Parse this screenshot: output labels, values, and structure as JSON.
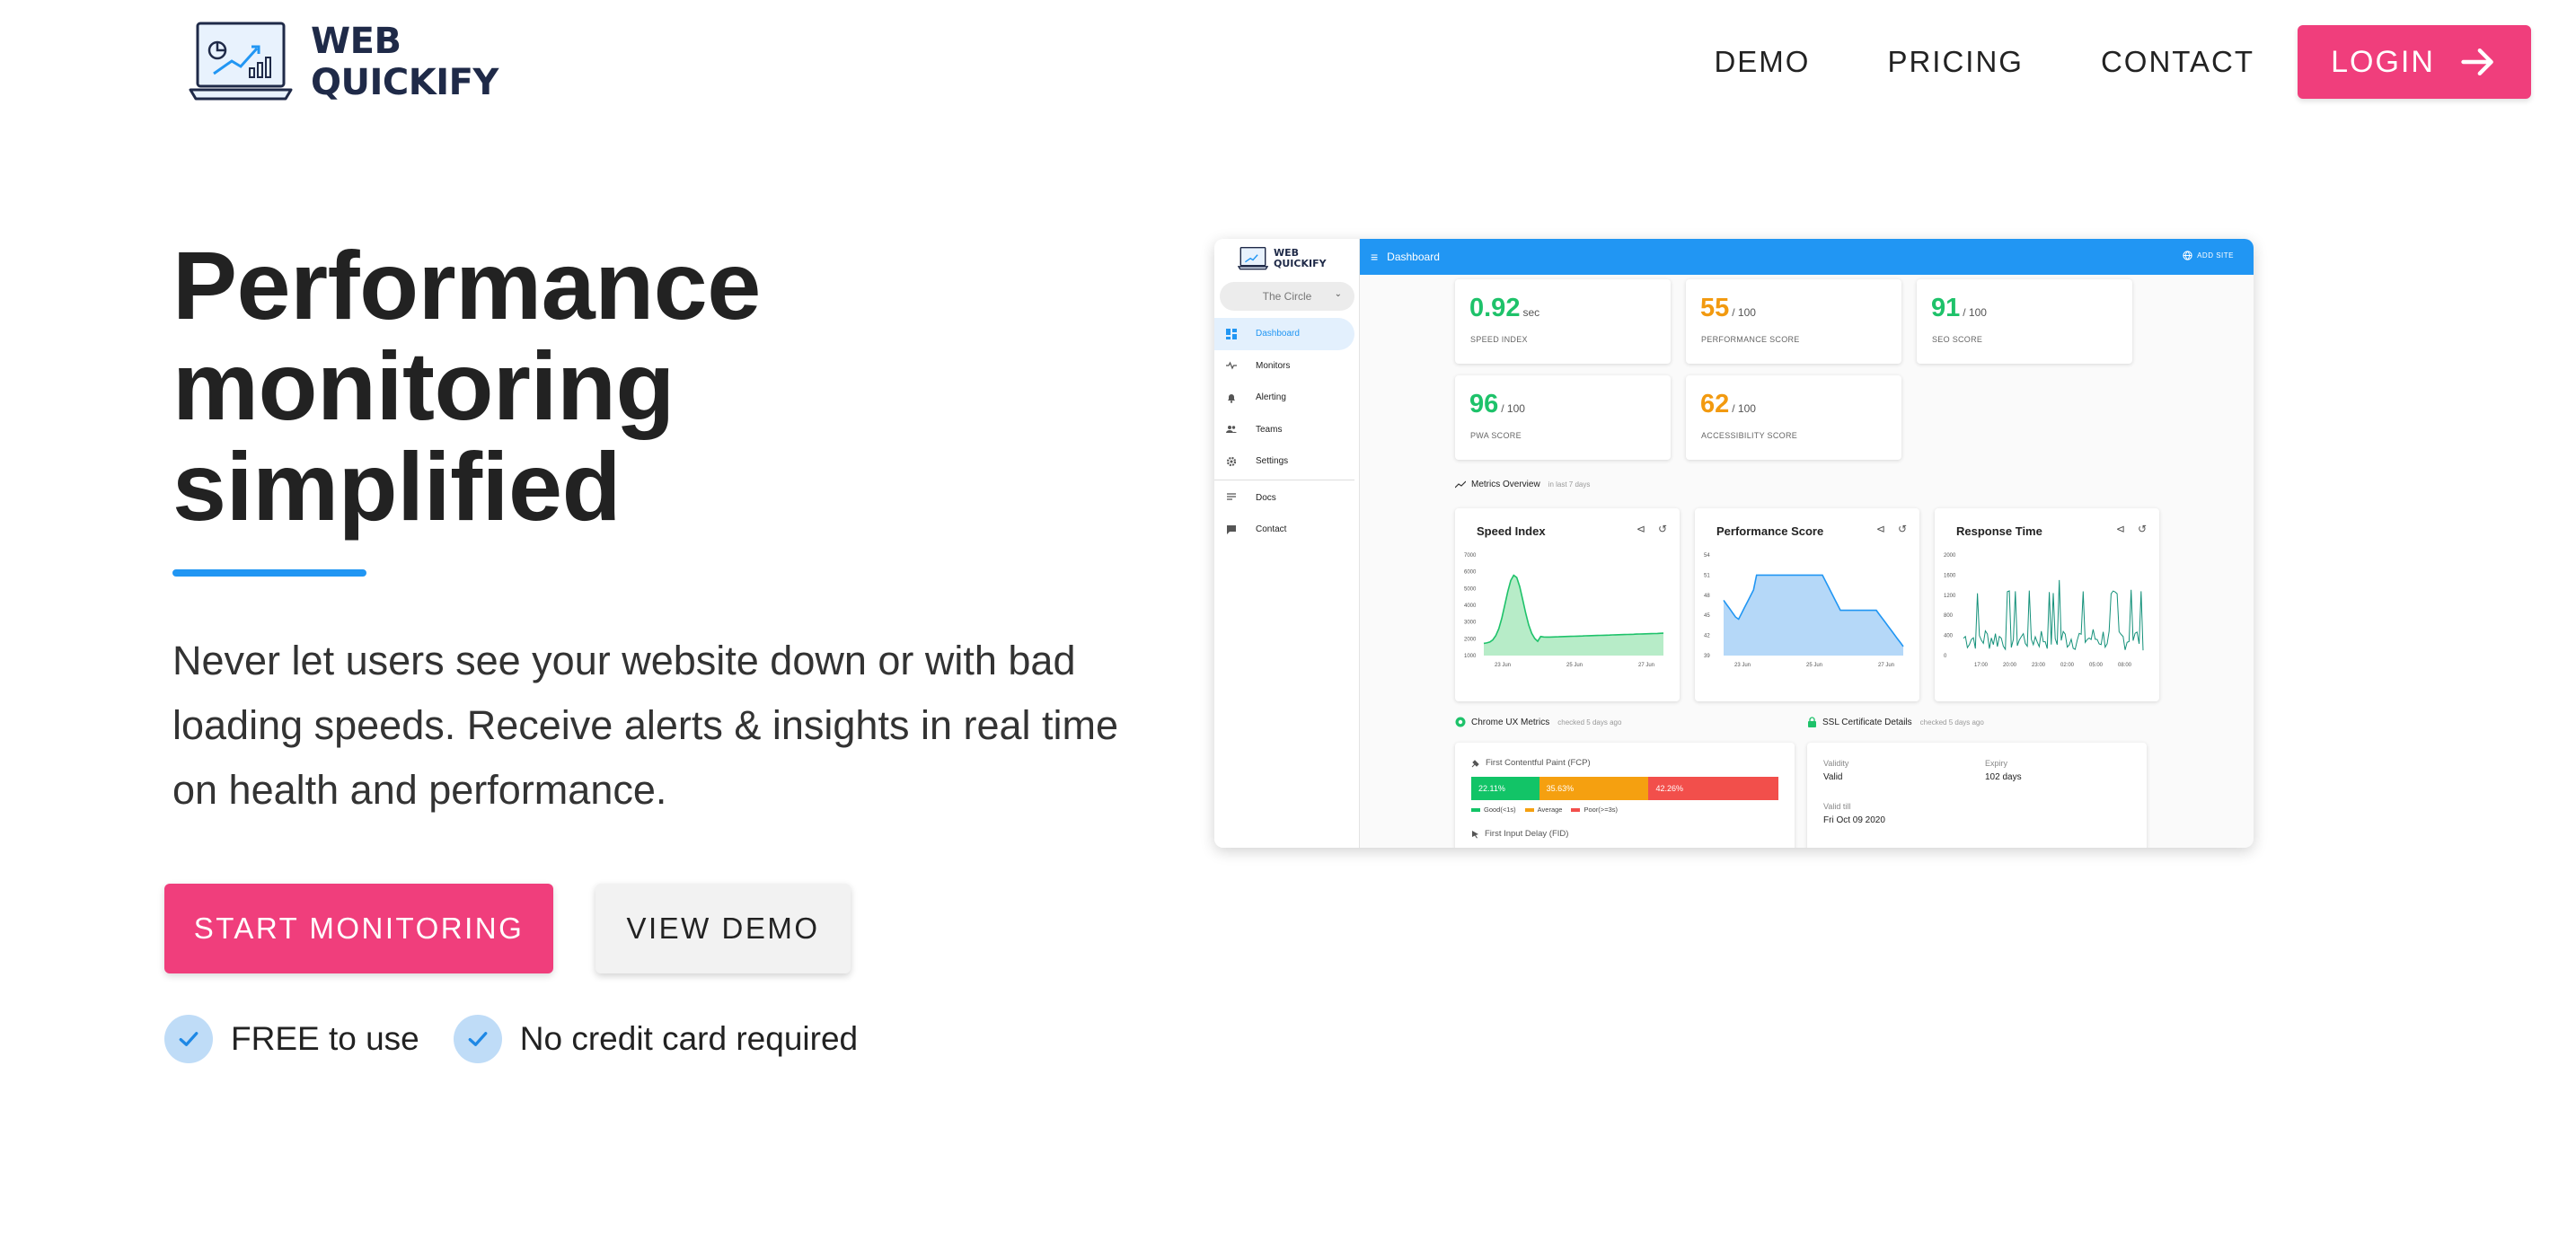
{
  "nav": {
    "logo_line1": "WEB",
    "logo_line2": "QUICKIFY",
    "links": [
      "DEMO",
      "PRICING",
      "CONTACT"
    ],
    "login_label": "LOGIN"
  },
  "hero": {
    "title_line1": "Performance",
    "title_line2": "monitoring",
    "title_line3": "simplified",
    "description": "Never let users see your website down or with bad loading speeds. Receive alerts & insights in real time on health and performance.",
    "cta_primary": "START MONITORING",
    "cta_secondary": "VIEW DEMO",
    "checks": [
      "FREE to use",
      "No credit card required"
    ]
  },
  "dashboard": {
    "logo_line1": "WEB",
    "logo_line2": "QUICKIFY",
    "site_select": "The Circle",
    "nav": [
      "Dashboard",
      "Monitors",
      "Alerting",
      "Teams",
      "Settings",
      "Docs",
      "Contact"
    ],
    "topbar_title": "Dashboard",
    "add_site": "ADD SITE",
    "scores": [
      {
        "value": "0.92",
        "unit": "sec",
        "label": "SPEED INDEX",
        "color": "#1ec26a"
      },
      {
        "value": "55",
        "unit": "/ 100",
        "label": "PERFORMANCE SCORE",
        "color": "#f29a10"
      },
      {
        "value": "91",
        "unit": "/ 100",
        "label": "SEO SCORE",
        "color": "#1ec26a"
      },
      {
        "value": "96",
        "unit": "/ 100",
        "label": "PWA SCORE",
        "color": "#1ec26a"
      },
      {
        "value": "62",
        "unit": "/ 100",
        "label": "ACCESSIBILITY SCORE",
        "color": "#f29a10"
      }
    ],
    "metrics_overview": "Metrics Overview",
    "metrics_overview_sub": "in last 7 days",
    "charts": [
      {
        "title": "Speed Index",
        "yticks": [
          "7000",
          "6000",
          "5000",
          "4000",
          "3000",
          "2000",
          "1000"
        ],
        "xticks": [
          "23 Jun",
          "25 Jun",
          "27 Jun"
        ],
        "color": "#1ec26a",
        "fill": "#b7ecc8"
      },
      {
        "title": "Performance Score",
        "yticks": [
          "54",
          "51",
          "48",
          "45",
          "42",
          "39"
        ],
        "xticks": [
          "23 Jun",
          "25 Jun",
          "27 Jun"
        ],
        "color": "#2196f3",
        "fill": "#b5d8f8"
      },
      {
        "title": "Response Time",
        "yticks": [
          "2000",
          "1600",
          "1200",
          "800",
          "400",
          "0"
        ],
        "xticks": [
          "17:00",
          "20:00",
          "23:00",
          "02:00",
          "05:00",
          "08:00"
        ],
        "color": "#14917a",
        "fill": "none"
      }
    ],
    "crux_title": "Chrome UX Metrics",
    "crux_sub": "checked 5 days ago",
    "ssl_title": "SSL Certificate Details",
    "ssl_sub": "checked 5 days ago",
    "fcp_label": "First Contentful Paint (FCP)",
    "fcp_segments": [
      {
        "label": "22.11%",
        "value": 22.11,
        "color": "#12c467"
      },
      {
        "label": "35.63%",
        "value": 35.63,
        "color": "#f5a010"
      },
      {
        "label": "42.26%",
        "value": 42.26,
        "color": "#f24f4b"
      }
    ],
    "fcp_legend": [
      "Good(<1s)",
      "Average",
      "Poor(>=3s)"
    ],
    "fid_label": "First Input Delay (FID)",
    "ssl": {
      "validity_label": "Validity",
      "validity_value": "Valid",
      "expiry_label": "Expiry",
      "expiry_value": "102 days",
      "valid_till_label": "Valid till",
      "valid_till_value": "Fri Oct 09 2020"
    }
  }
}
